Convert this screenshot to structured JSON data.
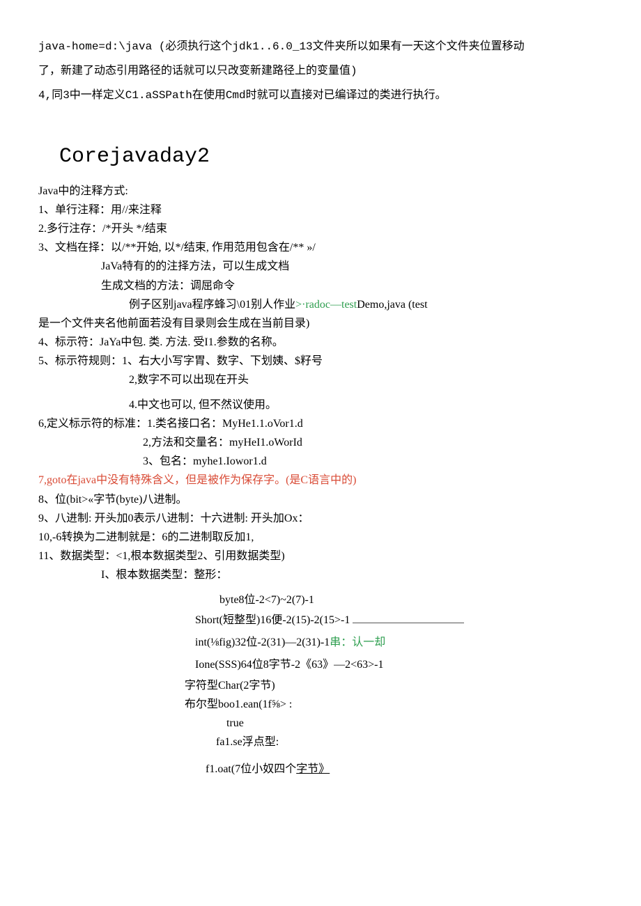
{
  "p1": "  java-home=d:\\java          (必须执行这个jdk1..6.0_13文件夹所以如果有一天这个文件夹位置移动了，新建了动态引用路径的话就可以只改变新建路径上的变量值)",
  "p2": "4,同3中一样定义C1.aSSPath在使用Cmd时就可以直接对已编译过的类进行执行。",
  "h1": "Corejavaday2",
  "l1": "Java中的注释方式:",
  "l2": "1、单行注释：用//来注释",
  "l3": "2.多行注存：/*开头      */结束",
  "l4": "3、文档在择：以/**开始, 以*/结束, 作用范用包含在/**                  »/",
  "l5": "JaVa特有的的注择方法，可以生成文档",
  "l6": "生成文档的方法：调屈命令",
  "l7a": "例子区别java程序蜂习\\01别人作业",
  "l7b": ">·radoc—test",
  "l7c": "Demo,java                                  (test",
  "l8": "是一个文件夹名他前面若没有目录则会生成在当前目录)",
  "l9": "4、标示符：JaYa中包. 类. 方法. 受I1.参数的名称。",
  "l10": "5、标示符规则：1、右大小写字胃、数字、下划姨、$籽号",
  "l11": "2,数字不可以出现在开头",
  "l12": "4.中文也可以, 但不然议使用。",
  "l13": "6,定义标示符的标准：1.类名接口名：MyHe1.1.oVor1.d",
  "l14": "2,方法和交量名：myHeI1.oWorId",
  "l15": "3、包名：myhe1.Iowor1.d",
  "l16": "7,goto在java中没有特殊含义，但是被作为保存字。(是C语言中的)",
  "l17": "8、位(bit>«字节(byte)八进制。",
  "l18": "9、八进制: 开头加0表示八进制：十六进制: 开头加Ox：",
  "l19": "10,-6转换为二进制就是：6的二进制取反加1,",
  "l20": "11、数据类型：<1,根本数据类型2、引用数据类型)",
  "l21": "I、根本数据类型：整形：",
  "l22": "byte8位-2<7)~2(7)-1",
  "l23": "Short(短整型)16便-2(15)-2(15>-1 ",
  "l24a": "int(⅛fig)32位-2(31)—2(31)-1",
  "l24b": "串：认一却",
  "l25": "Ione(SSS)64位8字节-2《63》—2<63>-1",
  "l26": "字符型Char(2字节)",
  "l27": "布尔型boo1.ean(1f⅝>          :",
  "l28": "true",
  "l29": "fa1.se浮点型:",
  "l30a": "f1.oat(7位小奴四个",
  "l30b": "字节》"
}
